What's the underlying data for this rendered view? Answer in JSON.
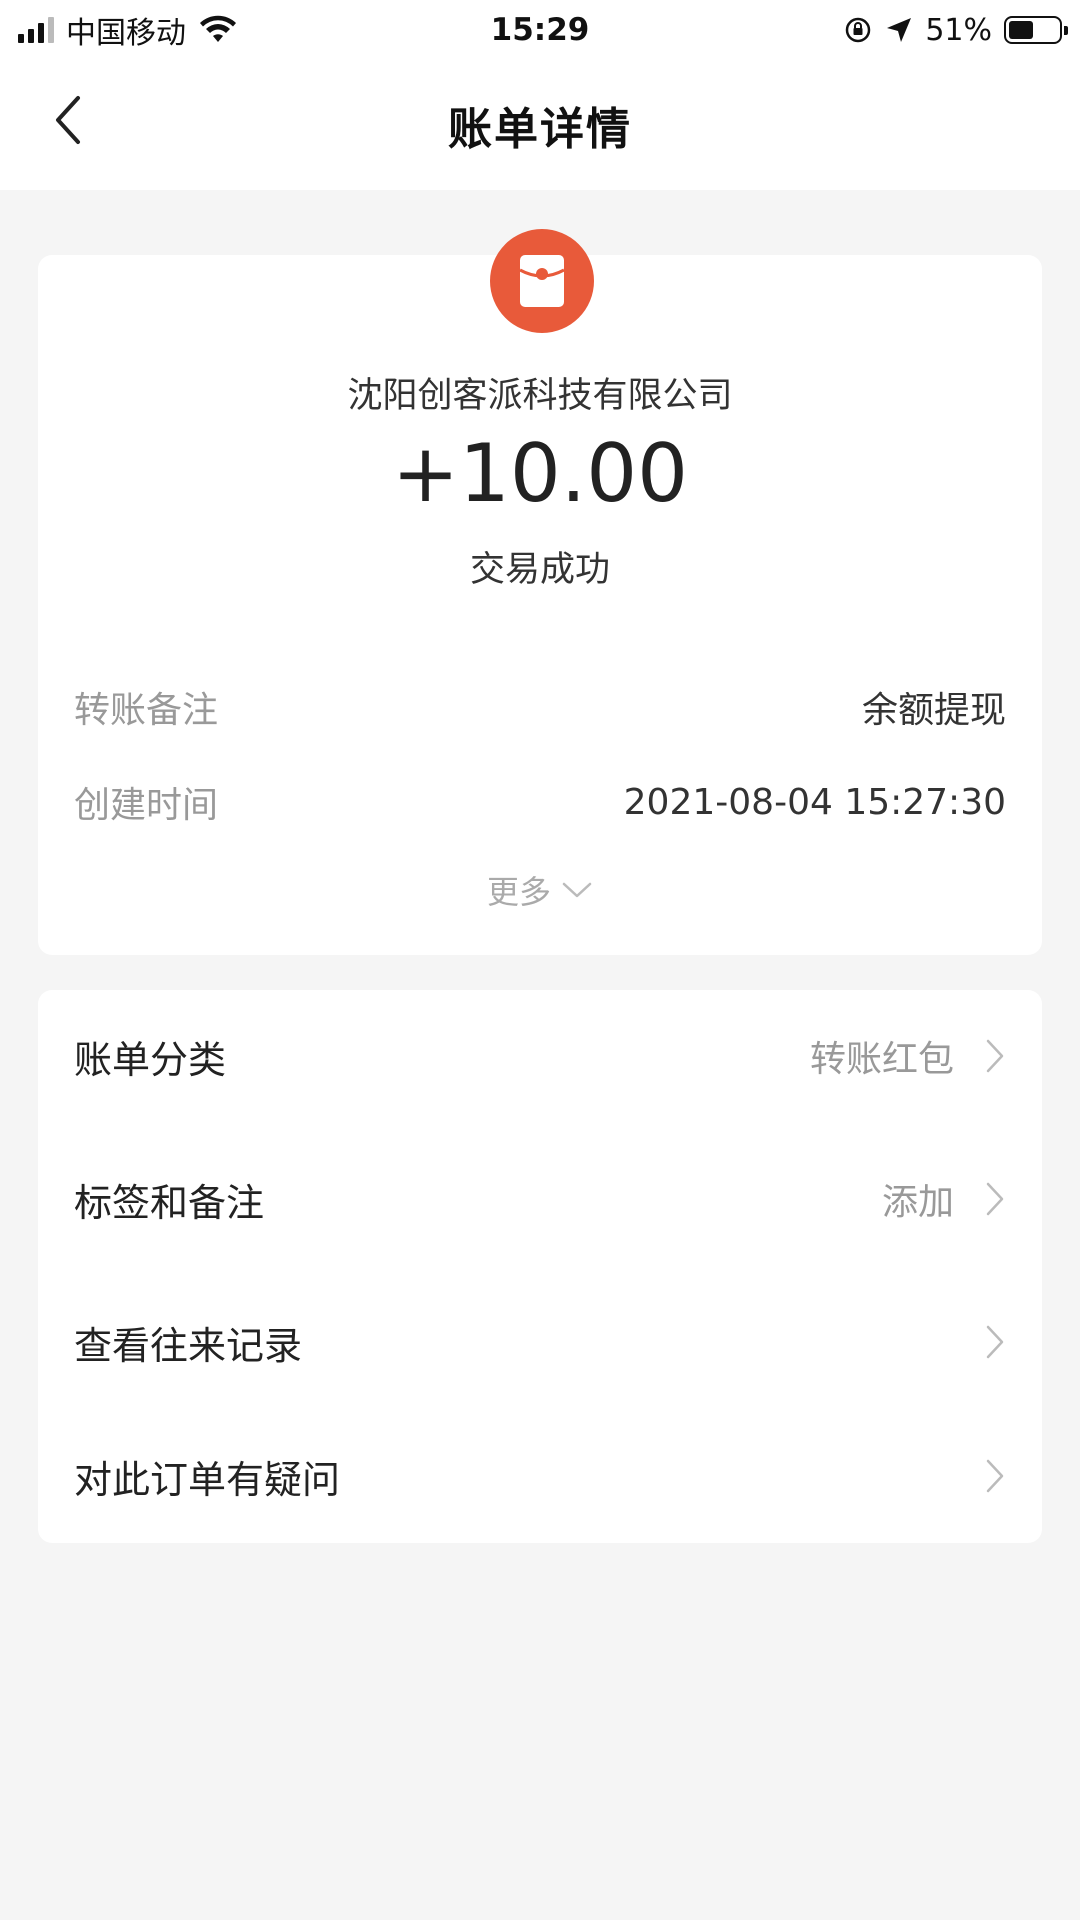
{
  "status_bar": {
    "carrier": "中国移动",
    "time": "15:29",
    "battery_percent": "51%",
    "battery_level": 0.51
  },
  "nav": {
    "title": "账单详情",
    "back_icon": "chevron-left-icon"
  },
  "summary": {
    "merchant_name": "沈阳创客派科技有限公司",
    "amount": "+10.00",
    "status": "交易成功",
    "avatar_color": "#e85a3a",
    "details": [
      {
        "label": "转账备注",
        "value": "余额提现"
      },
      {
        "label": "创建时间",
        "value": "2021-08-04 15:27:30"
      }
    ],
    "more_label": "更多"
  },
  "menu": [
    {
      "label": "账单分类",
      "value": "转账红包"
    },
    {
      "label": "标签和备注",
      "value": "添加"
    },
    {
      "label": "查看往来记录",
      "value": ""
    },
    {
      "label": "对此订单有疑问",
      "value": ""
    }
  ]
}
